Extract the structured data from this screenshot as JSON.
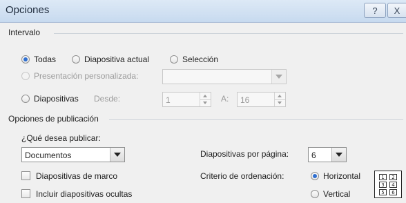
{
  "window": {
    "title": "Opciones",
    "help_label": "?",
    "close_label": "X"
  },
  "range": {
    "title": "Intervalo",
    "all": {
      "label": "Todas",
      "selected": true
    },
    "current_slide": {
      "label": "Diapositiva actual",
      "selected": false
    },
    "selection": {
      "label": "Selección",
      "selected": false
    },
    "custom_show": {
      "label": "Presentación personalizada:",
      "value": "",
      "enabled": false
    },
    "slides": {
      "label": "Diapositivas",
      "from_label": "Desde:",
      "from_value": "1",
      "to_label": "A:",
      "to_value": "16"
    }
  },
  "publish": {
    "title": "Opciones de publicación",
    "what_label": "¿Qué desea publicar:",
    "what_value": "Documentos",
    "slides_per_page_label": "Diapositivas por página:",
    "slides_per_page_value": "6",
    "order_label": "Criterio de ordenación:",
    "horizontal": {
      "label": "Horizontal",
      "selected": true
    },
    "vertical": {
      "label": "Vertical",
      "selected": false
    },
    "frame_slides": {
      "label": "Diapositivas de marco",
      "checked": false
    },
    "hidden_slides": {
      "label": "Incluir diapositivas ocultas",
      "checked": false
    },
    "preview_numbers": [
      "1",
      "2",
      "3",
      "4",
      "5",
      "6"
    ]
  }
}
